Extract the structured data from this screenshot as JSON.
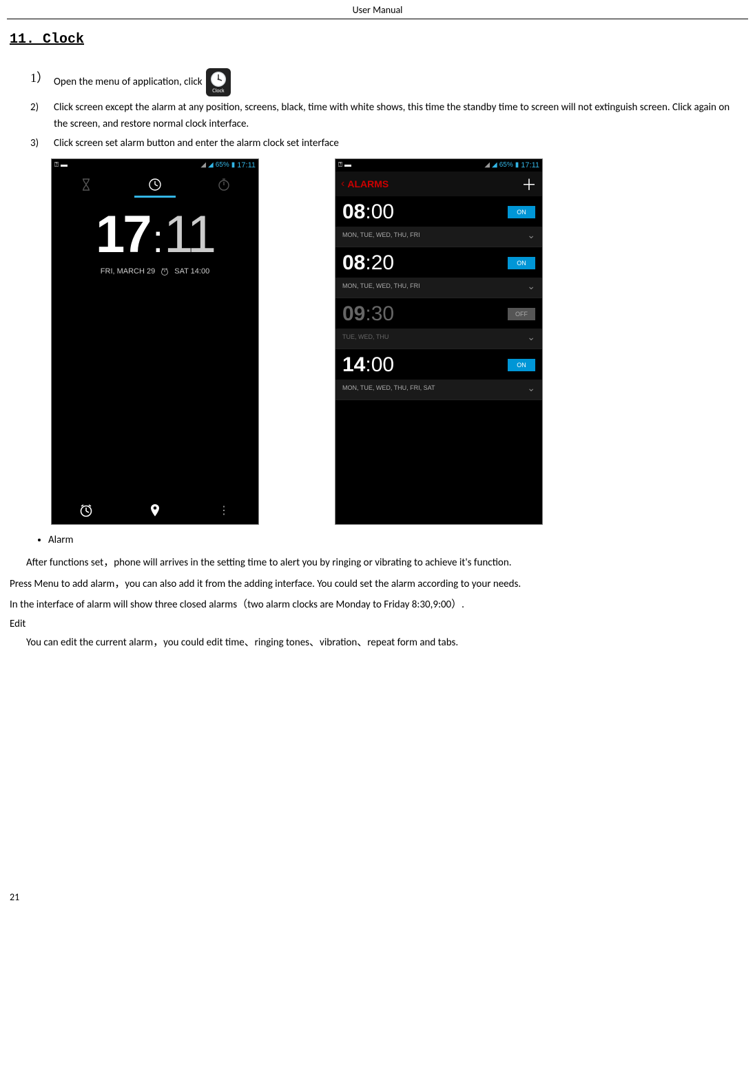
{
  "header": "User    Manual",
  "section_title": "11. Clock",
  "page_number": "21",
  "clock_icon_label": "Clock",
  "steps": {
    "s1_num": "1）",
    "s1_text_a": "Open the menu of application, click",
    "s2_num": "2)",
    "s2_text": "Click screen except the alarm at any position, screens, black, time with white shows, this time the standby time to screen will not extinguish screen. Click again on the screen, and restore normal clock interface.",
    "s3_num": "3)",
    "s3_text": "Click screen set alarm button and enter the alarm clock set interface"
  },
  "status": {
    "battery": "65%",
    "clock": "17:11"
  },
  "phone1": {
    "hh": "17",
    "mm": "11",
    "date": "FRI, MARCH 29",
    "next_alarm": "SAT 14:00"
  },
  "phone2": {
    "title": "ALARMS",
    "alarms": [
      {
        "h": "08",
        "m": "00",
        "days": "MON, TUE, WED, THU, FRI",
        "on": true
      },
      {
        "h": "08",
        "m": "20",
        "days": "MON, TUE, WED, THU, FRI",
        "on": true
      },
      {
        "h": "09",
        "m": "30",
        "days": "TUE, WED, THU",
        "on": false
      },
      {
        "h": "14",
        "m": "00",
        "days": "MON, TUE, WED, THU, FRI, SAT",
        "on": true
      }
    ],
    "on_label": "ON",
    "off_label": "OFF"
  },
  "body": {
    "bullet1": "Alarm",
    "p1": "After functions set，phone will arrives in the setting time to alert you by ringing or vibrating to achieve it's function.",
    "p2": "Press Menu to add alarm，you can also add it from the adding interface. You could set the alarm according to your needs.",
    "p3": "In the interface of alarm will show three closed alarms（two alarm clocks are Monday to Friday 8:30,9:00）.",
    "edit_head": "Edit",
    "p4": "You can edit the current alarm，you could edit time、ringing tones、vibration、repeat form and tabs."
  }
}
